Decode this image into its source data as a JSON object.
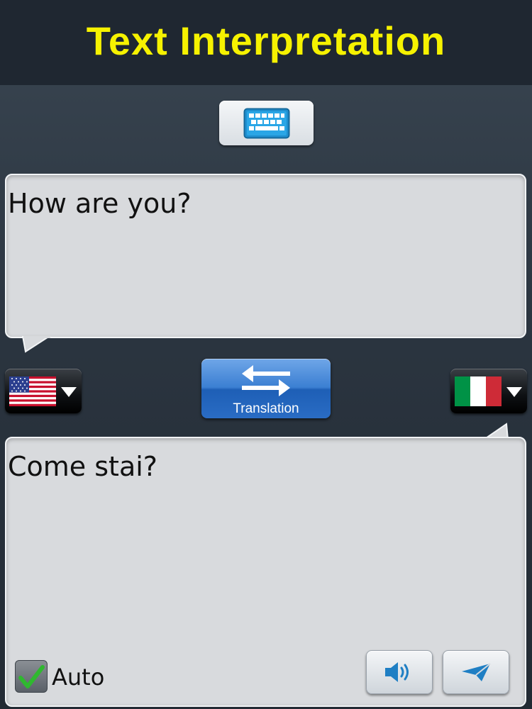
{
  "header": {
    "title": "Text Interpretation"
  },
  "input": {
    "text": "How are you?"
  },
  "output": {
    "text": "Come stai?"
  },
  "languages": {
    "source": {
      "flag": "us-flag-icon"
    },
    "target": {
      "flag": "italy-flag-icon"
    }
  },
  "toolbar": {
    "translate_label": "Translation"
  },
  "options": {
    "auto_label": "Auto",
    "auto_checked": true
  },
  "colors": {
    "title": "#f6f200",
    "accent": "#2a6cc4",
    "bubble": "#d8dadd"
  }
}
